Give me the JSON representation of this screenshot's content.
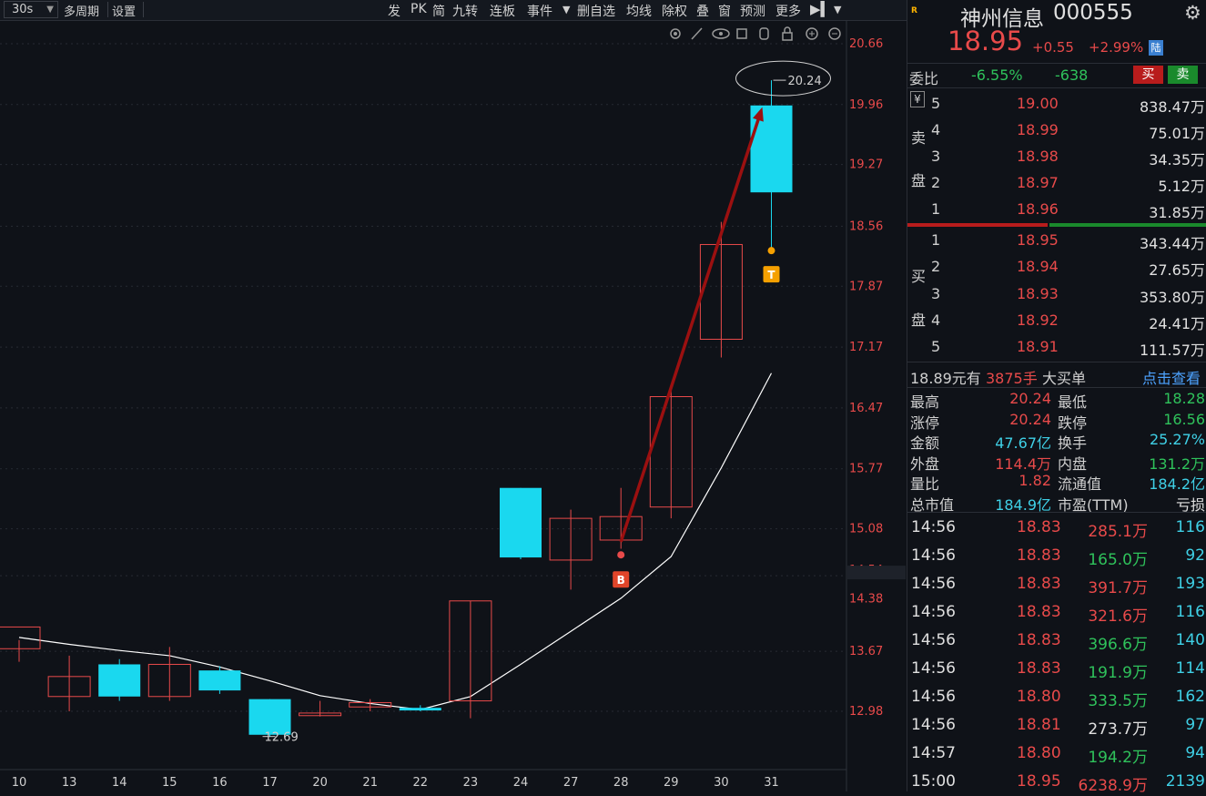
{
  "toolbar": {
    "period": "30s",
    "items": [
      "多周期",
      "设置",
      "发",
      "PK",
      "简",
      "九转",
      "连板",
      "事件",
      "删自选",
      "均线",
      "除权",
      "叠",
      "窗",
      "预测",
      "更多"
    ]
  },
  "chart_data": {
    "type": "candlestick",
    "x": [
      "10",
      "13",
      "14",
      "15",
      "16",
      "17",
      "20",
      "21",
      "22",
      "23",
      "24",
      "27",
      "28",
      "29",
      "30",
      "31"
    ],
    "candles": [
      {
        "o": 13.7,
        "h": 13.8,
        "l": 13.55,
        "c": 13.95
      },
      {
        "o": 13.15,
        "h": 13.62,
        "l": 12.98,
        "c": 13.38
      },
      {
        "o": 13.52,
        "h": 13.58,
        "l": 13.1,
        "c": 13.15
      },
      {
        "o": 13.15,
        "h": 13.72,
        "l": 13.1,
        "c": 13.52
      },
      {
        "o": 13.45,
        "h": 13.5,
        "l": 13.18,
        "c": 13.22
      },
      {
        "o": 13.12,
        "h": 13.12,
        "l": 12.69,
        "c": 12.71
      },
      {
        "o": 12.93,
        "h": 13.1,
        "l": 12.92,
        "c": 12.96
      },
      {
        "o": 13.03,
        "h": 13.12,
        "l": 12.98,
        "c": 13.08
      },
      {
        "o": 13.02,
        "h": 13.05,
        "l": 12.98,
        "c": 12.99
      },
      {
        "o": 13.1,
        "h": 14.25,
        "l": 12.9,
        "c": 14.25
      },
      {
        "o": 15.55,
        "h": 15.55,
        "l": 14.73,
        "c": 14.75
      },
      {
        "o": 14.72,
        "h": 15.3,
        "l": 14.38,
        "c": 15.2
      },
      {
        "o": 14.95,
        "h": 15.55,
        "l": 14.85,
        "c": 15.22
      },
      {
        "o": 15.33,
        "h": 16.67,
        "l": 15.2,
        "c": 16.6
      },
      {
        "o": 17.26,
        "h": 18.61,
        "l": 17.05,
        "c": 18.35
      },
      {
        "o": 19.95,
        "h": 20.24,
        "l": 18.28,
        "c": 18.95
      }
    ],
    "ma": [
      13.83,
      13.75,
      13.68,
      13.62,
      13.49,
      13.33,
      13.16,
      13.07,
      13.0,
      13.15,
      13.52,
      13.9,
      14.28,
      14.76,
      15.78,
      16.87
    ],
    "y_ticks": [
      "20.66",
      "19.96",
      "19.27",
      "18.56",
      "17.87",
      "17.17",
      "16.47",
      "15.77",
      "15.08",
      "14.54",
      "14.38",
      "13.67",
      "12.98"
    ],
    "ylim": [
      12.98,
      20.66
    ],
    "high_label": "20.24",
    "low_label": "12.69",
    "buy_marker": "B",
    "sell_marker": "T"
  },
  "stock": {
    "name": "神州信息",
    "code": "000555",
    "price": "18.95",
    "change": "+0.55",
    "change_pct": "+2.99%",
    "market_badge": "陆",
    "weibi_label": "委比",
    "weibi_pct": "-6.55%",
    "weibi_val": "-638",
    "buy_btn": "买",
    "sell_btn": "卖"
  },
  "sell_side": {
    "side_chars": [
      "卖",
      "盘"
    ],
    "rows": [
      {
        "level": "5",
        "price": "19.00",
        "vol": "838.47万"
      },
      {
        "level": "4",
        "price": "18.99",
        "vol": "75.01万"
      },
      {
        "level": "3",
        "price": "18.98",
        "vol": "34.35万"
      },
      {
        "level": "2",
        "price": "18.97",
        "vol": "5.12万"
      },
      {
        "level": "1",
        "price": "18.96",
        "vol": "31.85万"
      }
    ]
  },
  "buy_side": {
    "side_chars": [
      "买",
      "盘"
    ],
    "rows": [
      {
        "level": "1",
        "price": "18.95",
        "vol": "343.44万"
      },
      {
        "level": "2",
        "price": "18.94",
        "vol": "27.65万"
      },
      {
        "level": "3",
        "price": "18.93",
        "vol": "353.80万"
      },
      {
        "level": "4",
        "price": "18.92",
        "vol": "24.41万"
      },
      {
        "level": "5",
        "price": "18.91",
        "vol": "111.57万"
      }
    ]
  },
  "big_order": {
    "price_text": "18.89元有",
    "hands": "3875手",
    "label": "大买单",
    "link": "点击查看"
  },
  "stats": [
    {
      "l1": "最高",
      "v1": "20.24",
      "c1": "red",
      "l2": "最低",
      "v2": "18.28",
      "c2": "green"
    },
    {
      "l1": "涨停",
      "v1": "20.24",
      "c1": "red",
      "l2": "跌停",
      "v2": "16.56",
      "c2": "green"
    },
    {
      "l1": "金额",
      "v1": "47.67亿",
      "c1": "cyan",
      "l2": "换手",
      "v2": "25.27%",
      "c2": "cyan"
    },
    {
      "l1": "外盘",
      "v1": "114.4万",
      "c1": "red",
      "l2": "内盘",
      "v2": "131.2万",
      "c2": "green"
    },
    {
      "l1": "量比",
      "v1": "1.82",
      "c1": "red",
      "l2": "流通值",
      "v2": "184.2亿",
      "c2": "cyan"
    },
    {
      "l1": "总市值",
      "v1": "184.9亿",
      "c1": "cyan",
      "l2": "市盈(TTM)",
      "v2": "亏损",
      "c2": "white"
    }
  ],
  "trades": [
    {
      "time": "14:56",
      "price": "18.83",
      "vol": "285.1万",
      "vc": "red",
      "cnt": "116"
    },
    {
      "time": "14:56",
      "price": "18.83",
      "vol": "165.0万",
      "vc": "green",
      "cnt": "92"
    },
    {
      "time": "14:56",
      "price": "18.83",
      "vol": "391.7万",
      "vc": "red",
      "cnt": "193"
    },
    {
      "time": "14:56",
      "price": "18.83",
      "vol": "321.6万",
      "vc": "red",
      "cnt": "116"
    },
    {
      "time": "14:56",
      "price": "18.83",
      "vol": "396.6万",
      "vc": "green",
      "cnt": "140"
    },
    {
      "time": "14:56",
      "price": "18.83",
      "vol": "191.9万",
      "vc": "green",
      "cnt": "114"
    },
    {
      "time": "14:56",
      "price": "18.80",
      "vol": "333.5万",
      "vc": "green",
      "cnt": "162"
    },
    {
      "time": "14:56",
      "price": "18.81",
      "vol": "273.7万",
      "vc": "white",
      "cnt": "97"
    },
    {
      "time": "14:57",
      "price": "18.80",
      "vol": "194.2万",
      "vc": "green",
      "cnt": "94"
    },
    {
      "time": "15:00",
      "price": "18.95",
      "vol": "6238.9万",
      "vc": "red",
      "cnt": "2139"
    }
  ],
  "colors": {
    "up": "#e84a4a",
    "down": "#1ad8ef",
    "ma": "#ffffff",
    "arrow": "#9b1010",
    "bg": "#0f1218"
  }
}
